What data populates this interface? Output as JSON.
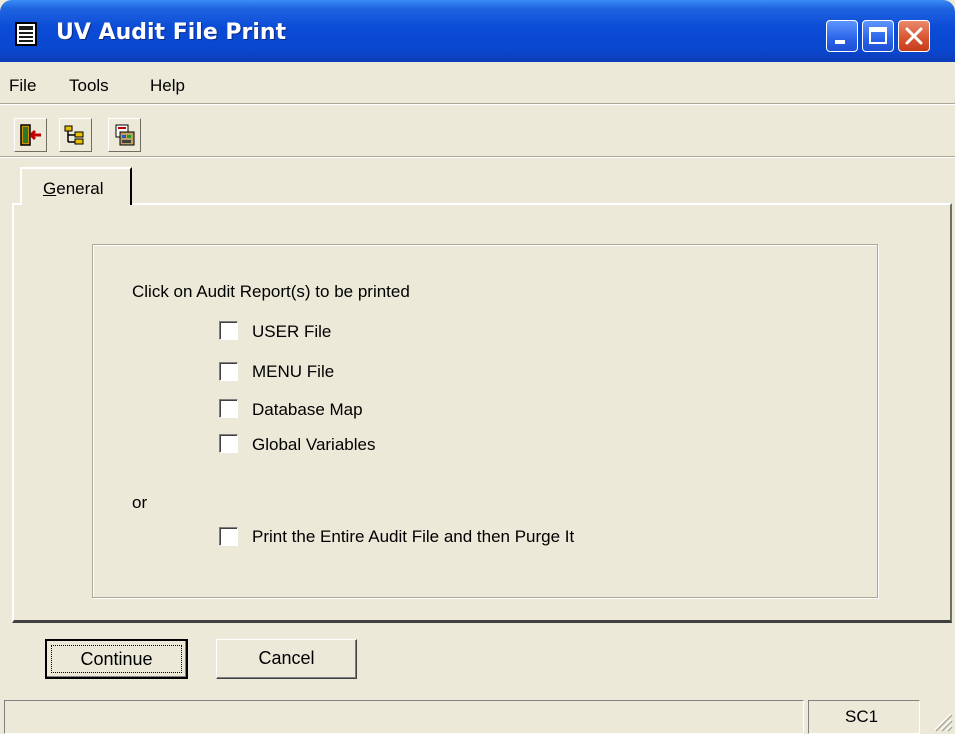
{
  "window": {
    "title": "UV Audit File Print",
    "icon": "document-list-icon",
    "controls": [
      "minimize-icon",
      "maximize-icon",
      "close-icon"
    ]
  },
  "menu": [
    "File",
    "Tools",
    "Help"
  ],
  "toolbar": [
    {
      "icon": "exit-door-icon"
    },
    {
      "icon": "tree-view-icon"
    },
    {
      "icon": "print-report-icon"
    }
  ],
  "tabs": [
    {
      "label_underlined": "G",
      "label_rest": "eneral"
    }
  ],
  "content": {
    "prompt": "Click on Audit Report(s) to be printed",
    "options": [
      "USER File",
      "MENU File",
      "Database Map",
      "Global Variables"
    ],
    "separator": "or",
    "purge_option": "Print the Entire Audit File and then Purge It"
  },
  "buttons": {
    "continue": "Continue",
    "cancel": "Cancel"
  },
  "status": {
    "pane2": "SC1"
  },
  "colors": {
    "titlebar": "#0a47cf",
    "face": "#ece9d8",
    "close": "#d7532e"
  }
}
